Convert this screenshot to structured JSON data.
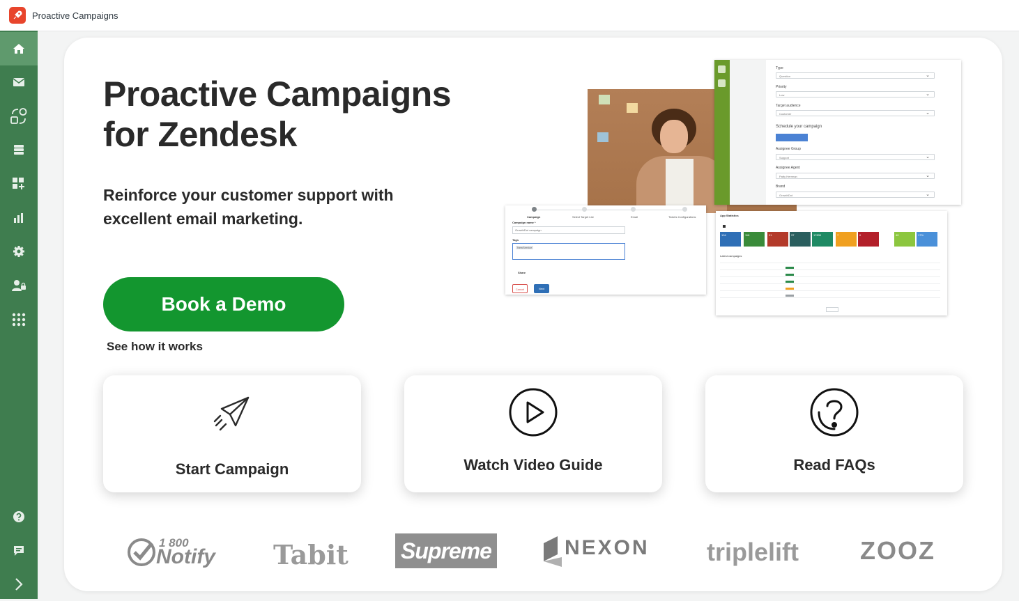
{
  "window": {
    "title": "Proactive Campaigns",
    "logo_icon": "rocket-logo-icon"
  },
  "colors": {
    "sidebar": "#3f7d4f",
    "sidebar_active": "#5f9a6d",
    "cta": "#13962f",
    "logo_bg": "#e8452c"
  },
  "sidebar": {
    "items": [
      {
        "icon": "home-icon",
        "active": true
      },
      {
        "icon": "mail-icon"
      },
      {
        "icon": "campaign-flow-icon"
      },
      {
        "icon": "list-icon"
      },
      {
        "icon": "apps-add-icon"
      },
      {
        "icon": "bar-chart-icon"
      },
      {
        "icon": "gear-icon"
      },
      {
        "icon": "user-lock-icon"
      },
      {
        "icon": "grid-dots-icon"
      }
    ],
    "bottom_items": [
      {
        "icon": "help-icon"
      },
      {
        "icon": "chat-icon"
      },
      {
        "icon": "chevron-right-icon"
      }
    ]
  },
  "hero": {
    "title": "Proactive Campaigns for Zendesk",
    "subtitle": "Reinforce your customer support with excellent email marketing.",
    "cta_label": "Book a Demo",
    "cta_sub": "See how it works"
  },
  "preview": {
    "form_fields": [
      {
        "label": "Type",
        "value": "Question"
      },
      {
        "label": "Priority",
        "value": "Low"
      },
      {
        "label": "Target audience",
        "value": "Customer"
      },
      {
        "label": "Schedule your campaign",
        "value": ""
      },
      {
        "label": "Assignee Group",
        "value": "Support"
      },
      {
        "label": "Assignee Agent",
        "value": "Patty Herrman"
      },
      {
        "label": "Brand",
        "value": "GrowthDot"
      }
    ],
    "wizard": {
      "steps": [
        "Campaign",
        "Select Target List",
        "Email",
        "Tickets Configurations"
      ],
      "name_label": "Campaign name *",
      "name_value": "GrowthDot campaign",
      "tags_label": "Tags",
      "tag_value": "NewService",
      "share_label": "Share",
      "cancel_label": "Cancel",
      "next_label": "Next"
    },
    "stats": {
      "title": "App Statistics",
      "tiles": [
        {
          "value": "104",
          "color": "#2f6fb6"
        },
        {
          "value": "116",
          "color": "#3a8b3a"
        },
        {
          "value": "21",
          "color": "#b33a2a"
        },
        {
          "value": "37",
          "color": "#2b5f5f"
        },
        {
          "value": "17830",
          "color": "#1f8a64"
        },
        {
          "value": "7",
          "color": "#f0a020"
        },
        {
          "value": "0",
          "color": "#b3202a"
        },
        {
          "value": "40",
          "color": "#8cc63f"
        },
        {
          "value": "17%",
          "color": "#4a90d9"
        }
      ],
      "table_title": "Latest campaigns"
    }
  },
  "cards": [
    {
      "label": "Start Campaign",
      "icon": "paper-plane-icon"
    },
    {
      "label": "Watch Video Guide",
      "icon": "play-circle-icon"
    },
    {
      "label": "Read FAQs",
      "icon": "question-circle-icon"
    }
  ],
  "logos": [
    {
      "name": "1800Notify",
      "line1": "1 800",
      "line2": "Notify"
    },
    {
      "name": "Tabit",
      "text": "Tabit"
    },
    {
      "name": "Supreme",
      "text": "Supreme"
    },
    {
      "name": "Nexon",
      "text": "NEXON"
    },
    {
      "name": "Triplelift",
      "text": "triplelift"
    },
    {
      "name": "Zooz",
      "text": "ZOOZ"
    }
  ]
}
